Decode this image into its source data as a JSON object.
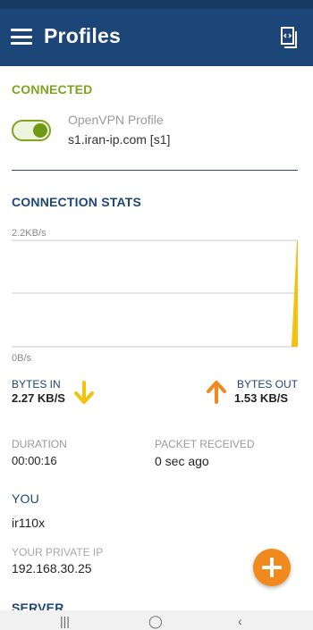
{
  "appbar": {
    "title": "Profiles"
  },
  "connection": {
    "status": "CONNECTED",
    "profile_name": "OpenVPN Profile",
    "server": "s1.iran-ip.com [s1]",
    "toggle_on": true
  },
  "stats": {
    "heading": "CONNECTION STATS",
    "chart_top_label": "2.2KB/s",
    "chart_bottom_label": "0B/s",
    "bytes_in_label": "BYTES IN",
    "bytes_in_value": "2.27 KB/S",
    "bytes_out_label": "BYTES OUT",
    "bytes_out_value": "1.53 KB/S",
    "duration_label": "DURATION",
    "duration_value": "00:00:16",
    "packet_label": "PACKET RECEIVED",
    "packet_value": "0 sec ago"
  },
  "you": {
    "heading": "YOU",
    "username": "ir110x",
    "private_ip_label": "YOUR PRIVATE IP",
    "private_ip_value": "192.168.30.25"
  },
  "server_section": {
    "heading": "SERVER"
  },
  "navbar": {
    "recents": "|||",
    "home": "◯",
    "back": "‹"
  },
  "colors": {
    "appbar": "#1d4678",
    "accent_green": "#7fa51c",
    "in_arrow": "#f2c20f",
    "out_arrow": "#f08a1d",
    "fab": "#f08a1d"
  }
}
